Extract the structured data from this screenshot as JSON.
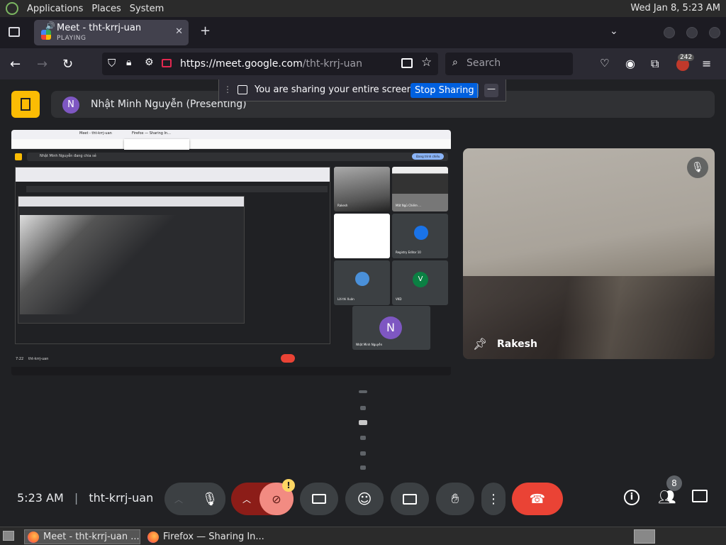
{
  "system_panel": {
    "menus": [
      "Applications",
      "Places",
      "System"
    ],
    "clock": "Wed Jan  8,  5:23 AM"
  },
  "browser": {
    "tab": {
      "title": "Meet - tht-krrj-uan",
      "status": "PLAYING"
    },
    "url_domain": "https://meet.google.com",
    "url_path": "/tht-krrj-uan",
    "search_placeholder": "Search",
    "badge_count": "242"
  },
  "share_banner": {
    "message": "You are sharing your entire screen.",
    "stop_label": "Stop Sharing",
    "minimize_label": "—"
  },
  "meet": {
    "presenter_initial": "N",
    "presenter_label": "Nhật Minh Nguyễn (Presenting)",
    "participant_name": "Rakesh",
    "meeting_time": "5:23 AM",
    "separator": "|",
    "meeting_code": "tht-krrj-uan",
    "people_count": "8",
    "warning_mark": "!",
    "share_inner": {
      "tab1": "Meet - tht-krrj-uan",
      "tab2": "Firefox — Sharing In...",
      "presenter_line": "Nhật Minh Nguyễn đang chia sẻ",
      "button": "Đang trình chiếu",
      "avatar_initial": "N",
      "v_initial": "V",
      "label_registry": "Registry Editor 10",
      "label_presenter": "Nhật Minh Nguyễn",
      "clock_label": "7:22",
      "code_label": "tht-krrj-uan",
      "tile_labels": [
        "Rakesh",
        "Mất Ngủ Chiếm ...",
        "Registry Editor 10 (Mạnh Dung)",
        "Registry Editor 10",
        "Lời thì Xuân",
        "VKD",
        "Nhật Minh Nguyễn"
      ]
    }
  },
  "taskbar": {
    "items": [
      "Meet - tht-krrj-uan ...",
      "Firefox — Sharing In..."
    ]
  },
  "colors": {
    "meet_bg": "#202124",
    "end_call": "#ea4335",
    "camera_off": "#f28b82",
    "avatar": "#7e57c2",
    "stop_sharing": "#0060df"
  }
}
